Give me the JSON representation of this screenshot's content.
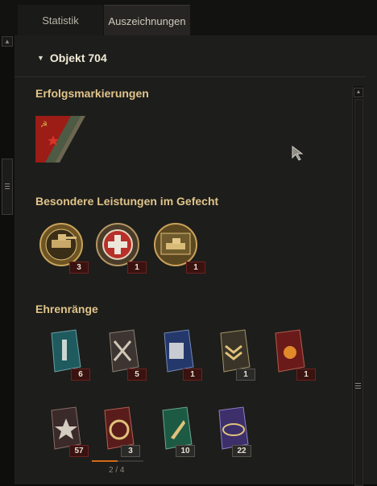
{
  "tabs": [
    {
      "label": "Statistik"
    },
    {
      "label": "Auszeichnungen"
    }
  ],
  "vehicle": {
    "name": "Objekt 704"
  },
  "sections": {
    "marks": "Erfolgsmarkierungen",
    "battle": "Besondere Leistungen im Gefecht",
    "ranks": "Ehrenränge"
  },
  "battle_medals": [
    {
      "icon": "tank-gun-medal-icon",
      "count": "3"
    },
    {
      "icon": "cross-shield-medal-icon",
      "count": "1"
    },
    {
      "icon": "tank-medal-icon",
      "count": "1"
    }
  ],
  "rank_medals": [
    {
      "icon": "sword-shield-rank-icon",
      "count": "6"
    },
    {
      "icon": "crossed-guns-rank-icon",
      "count": "5"
    },
    {
      "icon": "crate-rank-icon",
      "count": "1"
    },
    {
      "icon": "chevron-rank-icon",
      "count": "1"
    },
    {
      "icon": "flame-rank-icon",
      "count": "1"
    },
    {
      "icon": "star-wings-rank-icon",
      "count": "57"
    },
    {
      "icon": "compass-rank-icon",
      "count": "3"
    },
    {
      "icon": "spear-rank-icon",
      "count": "10"
    },
    {
      "icon": "orbit-rank-icon",
      "count": "22"
    }
  ],
  "progress": {
    "text": "2 / 4",
    "value": 0.5
  },
  "colors": {
    "accent": "#e0c48a",
    "count_bg": "#3a1210",
    "progress": "#d06a1a"
  }
}
